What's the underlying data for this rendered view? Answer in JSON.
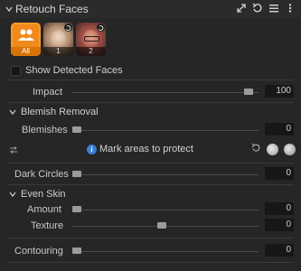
{
  "header": {
    "title": "Retouch Faces"
  },
  "faces": [
    {
      "label": "All",
      "selected": true
    },
    {
      "label": "1",
      "selected": false
    },
    {
      "label": "2",
      "selected": false
    }
  ],
  "show_detected": {
    "label": "Show Detected Faces",
    "checked": false
  },
  "impact": {
    "label": "Impact",
    "value": "100",
    "fraction": 0.95
  },
  "blemish": {
    "title": "Blemish Removal",
    "blemishes": {
      "label": "Blemishes",
      "value": "0",
      "fraction": 0.0
    },
    "mask_text": "Mark areas to protect"
  },
  "dark_circles": {
    "label": "Dark Circles",
    "value": "0",
    "fraction": 0.0
  },
  "even_skin": {
    "title": "Even Skin",
    "amount": {
      "label": "Amount",
      "value": "0",
      "fraction": 0.0
    },
    "texture": {
      "label": "Texture",
      "value": "0",
      "fraction": 0.48
    }
  },
  "contouring": {
    "label": "Contouring",
    "value": "0",
    "fraction": 0.0
  },
  "colors": {
    "accent": "#f08a1c",
    "info": "#3d7fd6"
  }
}
